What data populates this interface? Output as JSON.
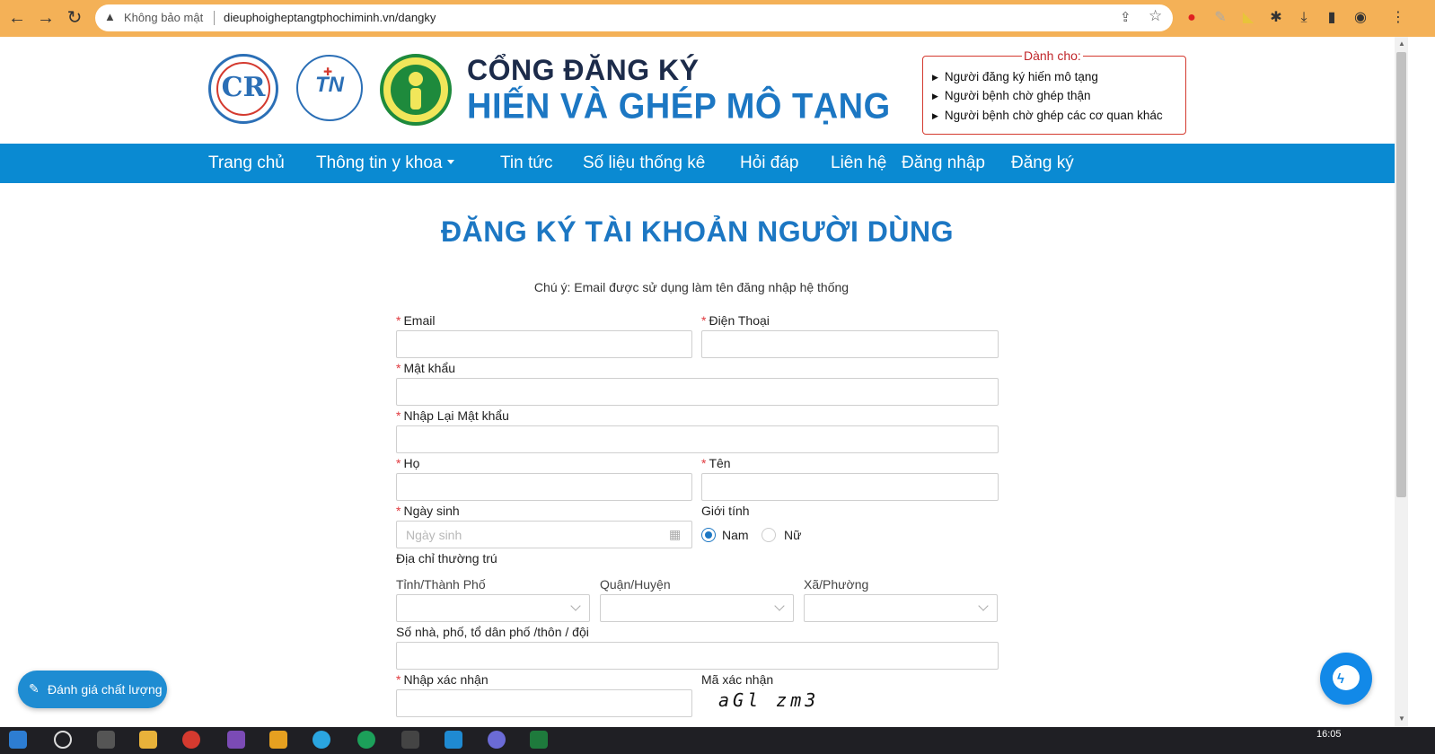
{
  "browser": {
    "security_label": "Không bảo mật",
    "url": "dieuphoigheptangtphochiminh.vn/dangky"
  },
  "header": {
    "portal_title_line1": "CỔNG ĐĂNG KÝ",
    "portal_title_line2": "HIẾN VÀ GHÉP MÔ TẠNG",
    "logos": [
      {
        "name": "Bệnh viện Chợ Rẫy",
        "mark": "CR"
      },
      {
        "name": "Bệnh viện Thống Nhất",
        "mark": "TN"
      },
      {
        "name": "Bệnh viện Nhi Đồng 2"
      }
    ],
    "for_box": {
      "title": "Dành cho:",
      "items": [
        "Người đăng ký hiến mô tạng",
        "Người bệnh chờ ghép thận",
        "Người bệnh chờ ghép các cơ quan khác"
      ]
    }
  },
  "nav": {
    "items": [
      "Trang chủ",
      "Thông tin y khoa",
      "Tin tức",
      "Số liệu thống kê",
      "Hỏi đáp",
      "Liên hệ",
      "Đăng nhập",
      "Đăng ký"
    ]
  },
  "form": {
    "title": "ĐĂNG KÝ TÀI KHOẢN NGƯỜI DÙNG",
    "note": "Chú ý: Email được sử dụng làm tên đăng nhập hệ thống",
    "required_mark": "*",
    "email_label": "Email",
    "phone_label": "Điện Thoại",
    "password_label": "Mật khẩu",
    "confirm_password_label": "Nhập Lại Mật khẩu",
    "last_name_label": "Họ",
    "first_name_label": "Tên",
    "dob_label": "Ngày sinh",
    "dob_placeholder": "Ngày sinh",
    "gender_label": "Giới tính",
    "gender_options": [
      "Nam",
      "Nữ"
    ],
    "gender_selected": "Nam",
    "address_label": "Địa chỉ thường trú",
    "province_label": "Tỉnh/Thành Phố",
    "district_label": "Quận/Huyện",
    "ward_label": "Xã/Phường",
    "street_label": "Số nhà, phố, tổ dân phố /thôn / đội",
    "captcha_input_label": "Nhập xác nhận",
    "captcha_label": "Mã xác nhận",
    "captcha_code": "aGl zm3"
  },
  "floating": {
    "rate_button": "Đánh giá chất lượng"
  },
  "taskbar": {
    "time": "16:05"
  },
  "colors": {
    "brand_blue": "#1c77c3",
    "nav_blue": "#0a8ad2",
    "required_red": "#e0393e",
    "chrome_orange": "#f4b157"
  }
}
